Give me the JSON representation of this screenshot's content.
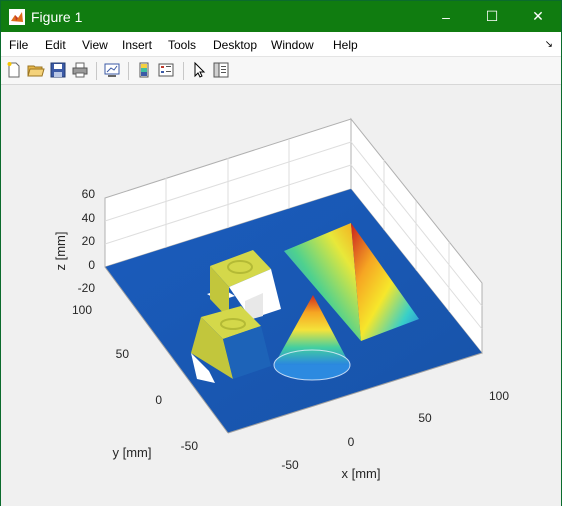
{
  "window": {
    "title": "Figure 1",
    "controls": {
      "minimize": "–",
      "maximize": "☐",
      "close": "✕"
    }
  },
  "menu": {
    "items": [
      "File",
      "Edit",
      "View",
      "Insert",
      "Tools",
      "Desktop",
      "Window",
      "Help"
    ],
    "overflow_arrow": "↘"
  },
  "toolbar": {
    "icons": [
      "new-figure-icon",
      "open-file-icon",
      "save-icon",
      "print-icon",
      "link-plot-icon",
      "insert-colorbar-icon",
      "insert-legend-icon",
      "edit-plot-icon",
      "property-inspector-icon"
    ]
  },
  "chart_data": {
    "type": "surface3d",
    "title": "",
    "xlabel": "x [mm]",
    "ylabel": "y [mm]",
    "zlabel": "z [mm]",
    "xlim": [
      -100,
      100
    ],
    "ylim": [
      -100,
      100
    ],
    "zlim": [
      -20,
      60
    ],
    "xticks": [
      -50,
      0,
      50,
      100
    ],
    "yticks": [
      -50,
      0,
      50,
      100
    ],
    "zticks": [
      -20,
      0,
      20,
      40,
      60
    ],
    "grid": true,
    "colormap": "parula-jet",
    "objects": [
      {
        "name": "pyramid",
        "height": 40
      },
      {
        "name": "cone",
        "height": 35
      },
      {
        "name": "box-back",
        "height": 20
      },
      {
        "name": "box-front",
        "height": 20
      }
    ]
  },
  "colors": {
    "titlebar": "#107c10",
    "surface_base": "#1f5fb6",
    "box_top": "#d4d84a"
  }
}
